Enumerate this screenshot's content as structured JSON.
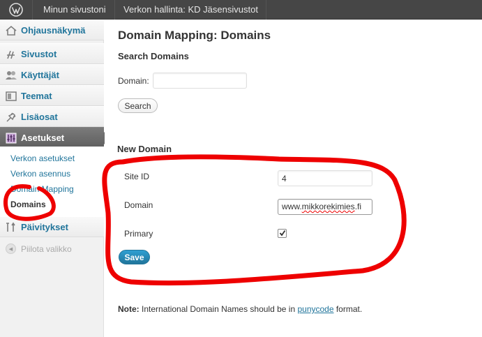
{
  "admin_bar": {
    "site_name": "Minun sivustoni",
    "network_admin": "Verkon hallinta: KD Jäsensivustot"
  },
  "sidebar": {
    "items": [
      {
        "label": "Ohjausnäkymä",
        "icon": "dashboard-icon"
      },
      {
        "label": "Sivustot",
        "icon": "sites-icon"
      },
      {
        "label": "Käyttäjät",
        "icon": "users-icon"
      },
      {
        "label": "Teemat",
        "icon": "themes-icon"
      },
      {
        "label": "Lisäosat",
        "icon": "plugins-icon"
      },
      {
        "label": "Asetukset",
        "icon": "settings-icon"
      },
      {
        "label": "Päivitykset",
        "icon": "updates-icon"
      }
    ],
    "submenu": [
      "Verkon asetukset",
      "Verkon asennus",
      "Domain Mapping",
      "Domains"
    ],
    "collapse_label": "Piilota valikko"
  },
  "main": {
    "title": "Domain Mapping: Domains",
    "search": {
      "heading": "Search Domains",
      "domain_label": "Domain:",
      "domain_value": "",
      "button": "Search"
    },
    "new_domain": {
      "heading": "New Domain",
      "site_id_label": "Site ID",
      "site_id_value": "4",
      "domain_label": "Domain",
      "domain_value_prefix": "www.",
      "domain_value_word": "mikkorekimies",
      "domain_value_suffix": ".fi",
      "primary_label": "Primary",
      "primary_checked": true,
      "save_button": "Save"
    },
    "note": {
      "bold": "Note:",
      "text_before": " International Domain Names should be in ",
      "link": "punycode",
      "text_after": " format."
    }
  },
  "colors": {
    "admin_bar": "#464646",
    "link": "#21759b",
    "annotation": "#ee0000",
    "active_menu": "#6c6c6c"
  }
}
